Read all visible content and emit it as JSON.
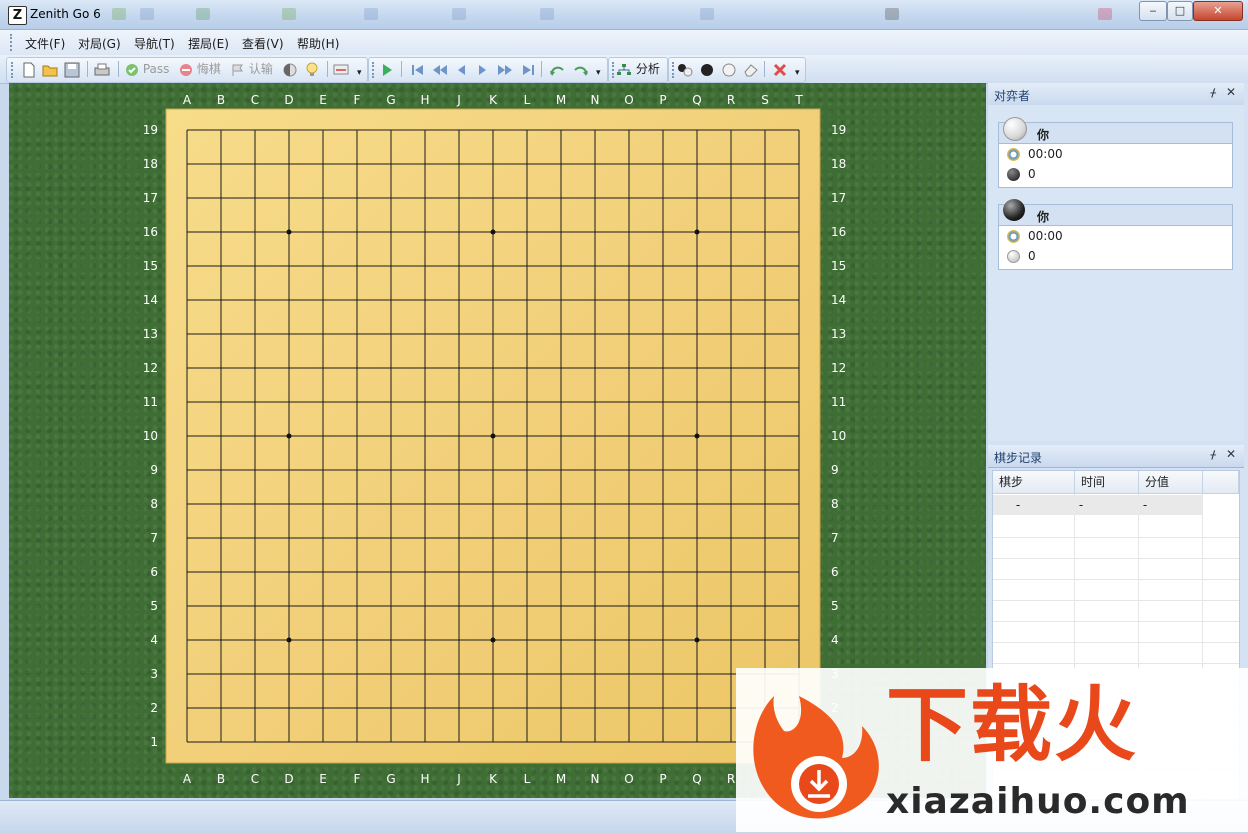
{
  "window": {
    "title": "Zenith Go 6",
    "icon_letter": "Z"
  },
  "menu": [
    "文件(F)",
    "对局(G)",
    "导航(T)",
    "摆局(E)",
    "查看(V)",
    "帮助(H)"
  ],
  "toolbar": {
    "pass_label": "Pass",
    "undo_label": "悔棋",
    "resign_label": "认输",
    "analyze_label": "分析"
  },
  "board": {
    "size": 19,
    "columns": [
      "A",
      "B",
      "C",
      "D",
      "E",
      "F",
      "G",
      "H",
      "J",
      "K",
      "L",
      "M",
      "N",
      "O",
      "P",
      "Q",
      "R",
      "S",
      "T"
    ],
    "rows": [
      "19",
      "18",
      "17",
      "16",
      "15",
      "14",
      "13",
      "12",
      "11",
      "10",
      "9",
      "8",
      "7",
      "6",
      "5",
      "4",
      "3",
      "2",
      "1"
    ],
    "hoshi": [
      "D16",
      "K16",
      "Q16",
      "D10",
      "K10",
      "Q10",
      "D4",
      "K4",
      "Q4"
    ],
    "felt_color": "#3f6e35",
    "wood_color": "#f2d07a"
  },
  "players_panel": {
    "title": "对弈者",
    "players": [
      {
        "stone": "white",
        "name": "你",
        "time": "00:00",
        "captured_stone": "black",
        "captures": "0"
      },
      {
        "stone": "black",
        "name": "你",
        "time": "00:00",
        "captured_stone": "white",
        "captures": "0"
      }
    ]
  },
  "moves_panel": {
    "title": "棋步记录",
    "columns": [
      "棋步",
      "时间",
      "分值"
    ],
    "rows": [
      [
        "-",
        "-",
        "-"
      ]
    ]
  },
  "watermark": {
    "title": "下载火",
    "url": "xiazaihuo.com"
  }
}
